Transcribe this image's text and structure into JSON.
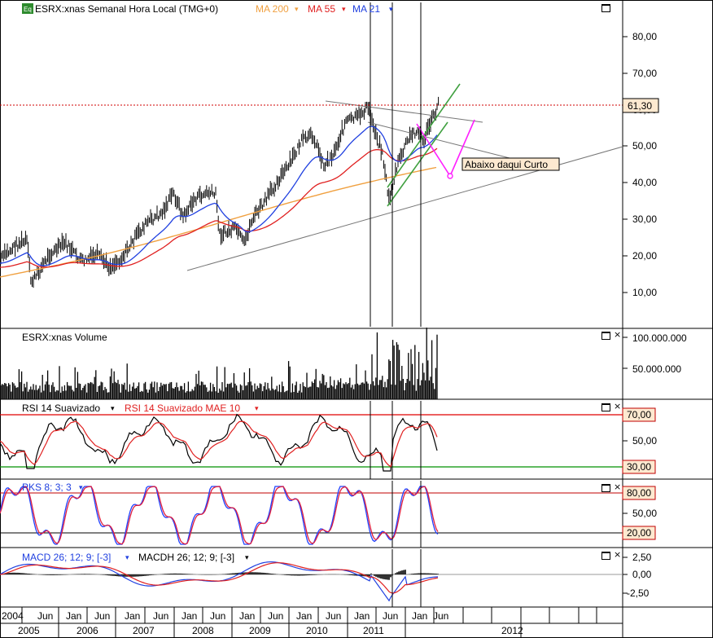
{
  "price_panel": {
    "symbol_badge": "Eq",
    "title": "ESRX:xnas Semanal Hora Local (TMG+0)",
    "ma200_label": "MA 200",
    "ma55_label": "MA 55",
    "ma21_label": "MA 21",
    "dropdown_glyph": "▾",
    "y_ticks": [
      "80,00",
      "70,00",
      "60,00",
      "50,00",
      "40,00",
      "30,00",
      "20,00",
      "10,00"
    ],
    "last_price": "61,30",
    "annotation": "Abaixo daqui Curto"
  },
  "volume_panel": {
    "title": "ESRX:xnas Volume",
    "y_ticks": [
      "100.000.000",
      "50.000.000"
    ]
  },
  "rsi_panel": {
    "title_1": "RSI 14 Suavizado",
    "title_2": "RSI 14 Suavizado MAE 10",
    "y_ticks": [
      "70,00",
      "50,00",
      "30,00"
    ]
  },
  "pks_panel": {
    "title": "PKS 8; 3; 3",
    "y_ticks": [
      "80,00",
      "50,00",
      "20,00"
    ]
  },
  "macd_panel": {
    "title_1": "MACD 26; 12; 9; [-3]",
    "title_2": "MACDH 26; 12; 9; [-3]",
    "y_ticks": [
      "2,50",
      "0,00",
      "-2,50"
    ]
  },
  "x_axis": {
    "months": [
      "2004",
      "Jun",
      "Jan",
      "Jun",
      "Jan",
      "Jun",
      "Jan",
      "Jun",
      "Jan",
      "Jun",
      "Jan",
      "Jun",
      "Jan",
      "Jun",
      "Jan",
      "Jun"
    ],
    "years": [
      "2005",
      "2006",
      "2007",
      "2008",
      "2009",
      "2010",
      "2011",
      "2012"
    ]
  },
  "colors": {
    "price_bars": "#000000",
    "ma200": "#f0a040",
    "ma55": "#e02020",
    "ma21": "#2040e0",
    "rsi_line": "#000000",
    "rsi_signal": "#e02020",
    "overbought_line": "#e00000",
    "oversold_line": "#009000",
    "pks_k": "#2040ff",
    "pks_d": "#e02040",
    "channel": "#40a040",
    "projection": "#ff20ff",
    "last_price_line": "#d00000",
    "value_box_bg": "#fde9d0"
  },
  "window_controls": {
    "close_glyph": "×"
  }
}
